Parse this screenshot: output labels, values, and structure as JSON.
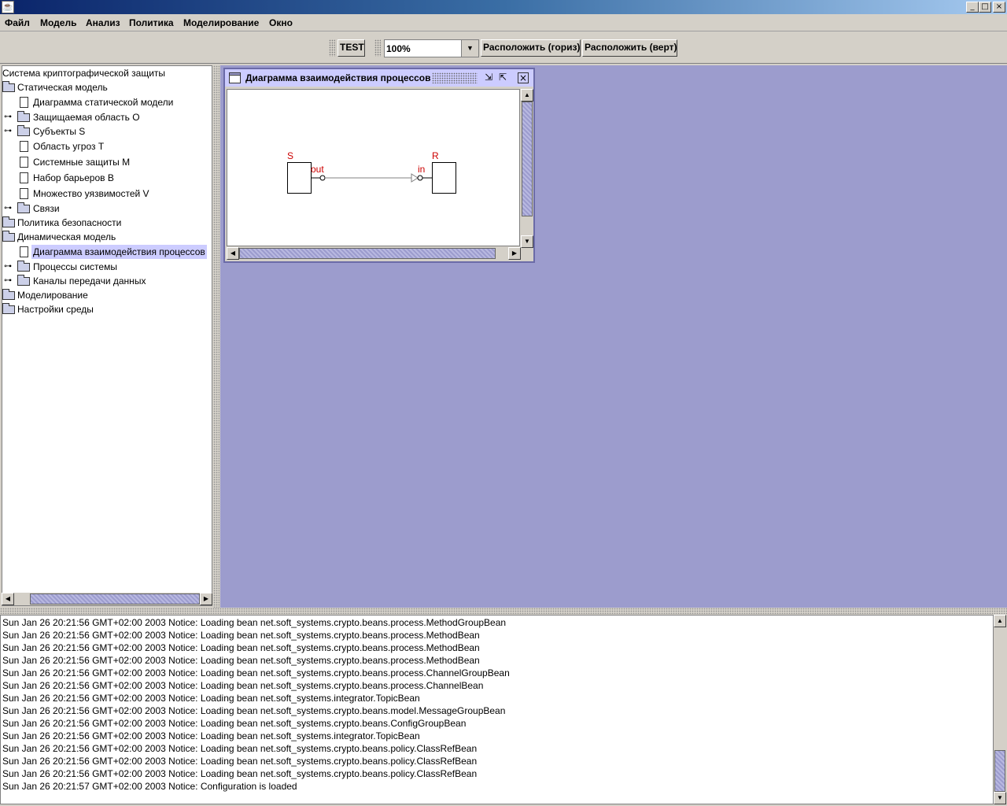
{
  "menu": {
    "items": [
      "Файл",
      "Модель",
      "Анализ",
      "Политика",
      "Моделирование",
      "Окно"
    ]
  },
  "toolbar": {
    "test_label": "TEST",
    "zoom_value": "100%",
    "arrange_horiz_label": "Расположить (гориз)",
    "arrange_vert_label": "Расположить (верт)"
  },
  "tree": {
    "root": "Система криптографической защиты",
    "items": [
      "Статическая модель",
      "Диаграмма статической модели",
      "Защищаемая область О",
      "Субъекты S",
      "Область угроз T",
      "Системные защиты M",
      "Набор барьеров B",
      "Множество уязвимостей V",
      "Связи",
      "Политика безопасности",
      "Динамическая модель",
      "Диаграмма взаимодействия процессов",
      "Процессы системы",
      "Каналы передачи данных",
      "Моделирование",
      "Настройки среды"
    ]
  },
  "internal_frame": {
    "title": "Диаграмма взаимодействия процессов"
  },
  "diagram": {
    "sender_name": "S",
    "receiver_name": "R",
    "out_port": "out",
    "in_port": "in",
    "label_color": "#cc0000"
  },
  "log": {
    "lines": [
      "Sun Jan 26 20:21:56 GMT+02:00 2003 Notice: Loading bean net.soft_systems.crypto.beans.process.MethodGroupBean",
      "Sun Jan 26 20:21:56 GMT+02:00 2003 Notice: Loading bean net.soft_systems.crypto.beans.process.MethodBean",
      "Sun Jan 26 20:21:56 GMT+02:00 2003 Notice: Loading bean net.soft_systems.crypto.beans.process.MethodBean",
      "Sun Jan 26 20:21:56 GMT+02:00 2003 Notice: Loading bean net.soft_systems.crypto.beans.process.MethodBean",
      "Sun Jan 26 20:21:56 GMT+02:00 2003 Notice: Loading bean net.soft_systems.crypto.beans.process.ChannelGroupBean",
      "Sun Jan 26 20:21:56 GMT+02:00 2003 Notice: Loading bean net.soft_systems.crypto.beans.process.ChannelBean",
      "Sun Jan 26 20:21:56 GMT+02:00 2003 Notice: Loading bean net.soft_systems.integrator.TopicBean",
      "Sun Jan 26 20:21:56 GMT+02:00 2003 Notice: Loading bean net.soft_systems.crypto.beans.model.MessageGroupBean",
      "Sun Jan 26 20:21:56 GMT+02:00 2003 Notice: Loading bean net.soft_systems.crypto.beans.ConfigGroupBean",
      "Sun Jan 26 20:21:56 GMT+02:00 2003 Notice: Loading bean net.soft_systems.integrator.TopicBean",
      "Sun Jan 26 20:21:56 GMT+02:00 2003 Notice: Loading bean net.soft_systems.crypto.beans.policy.ClassRefBean",
      "Sun Jan 26 20:21:56 GMT+02:00 2003 Notice: Loading bean net.soft_systems.crypto.beans.policy.ClassRefBean",
      "Sun Jan 26 20:21:56 GMT+02:00 2003 Notice: Loading bean net.soft_systems.crypto.beans.policy.ClassRefBean",
      "Sun Jan 26 20:21:57 GMT+02:00 2003 Notice: Configuration is loaded"
    ]
  }
}
